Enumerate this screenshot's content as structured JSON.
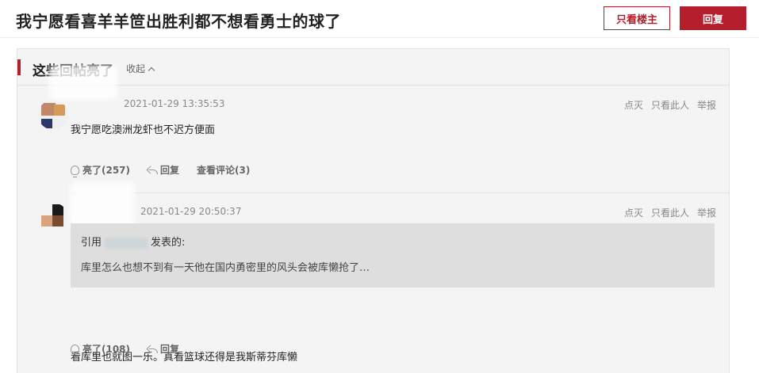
{
  "header": {
    "thread_title": "我宁愿看喜羊羊笸出胜利都不想看勇士的球了",
    "only_op_label": "只看楼主",
    "reply_label": "回复"
  },
  "section": {
    "title": "这些回帖亮了",
    "collapse_label": "收起"
  },
  "replies": [
    {
      "time": "2021-01-29 13:35:53",
      "actions": [
        "点灭",
        "只看此人",
        "举报"
      ],
      "content": "我宁愿吃澳洲龙虾也不迟方便面",
      "light_label": "亮了(257)",
      "reply_label": "回复",
      "comments_label": "查看评论(3)"
    },
    {
      "time": "2021-01-29 20:50:37",
      "actions": [
        "点灭",
        "只看此人",
        "举报"
      ],
      "quote": {
        "prefix": "引用",
        "suffix": "发表的:",
        "body": "库里怎么也想不到有一天他在国内勇密里的风头会被库懒抢了…"
      },
      "content": "看库里也就图一乐。真看篮球还得是我斯蒂芬库懒",
      "light_label": "亮了(108)",
      "reply_label": "回复"
    }
  ],
  "colors": {
    "accent": "#b11e2c",
    "panel_bg": "#f4f4f5",
    "quote_bg": "#dedede"
  },
  "icons": [
    "light-icon",
    "reply-icon",
    "chevron-up-icon"
  ]
}
